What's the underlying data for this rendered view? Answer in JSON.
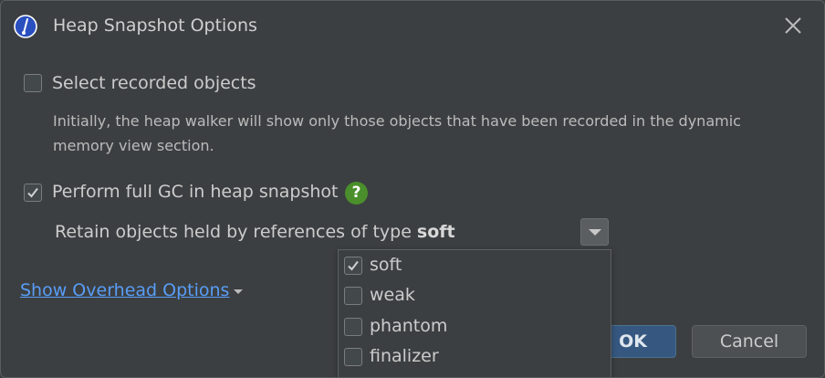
{
  "dialog": {
    "title": "Heap Snapshot Options",
    "icons": {
      "app": "jprofiler-icon",
      "close": "close-icon"
    }
  },
  "select_recorded": {
    "label": "Select recorded objects",
    "checked": false,
    "description": "Initially, the heap walker will show only those objects that have been recorded in the dynamic memory view section."
  },
  "full_gc": {
    "label": "Perform full GC in heap snapshot",
    "checked": true,
    "help_icon": "help-icon",
    "help_glyph": "?"
  },
  "retain": {
    "label": "Retain objects held by references of type",
    "selected": "soft",
    "options": [
      {
        "label": "soft",
        "checked": true
      },
      {
        "label": "weak",
        "checked": false
      },
      {
        "label": "phantom",
        "checked": false
      },
      {
        "label": "finalizer",
        "checked": false
      }
    ]
  },
  "overhead": {
    "label": "Show Overhead Options"
  },
  "buttons": {
    "ok": "OK",
    "cancel": "Cancel"
  },
  "colors": {
    "background": "#3c3f41",
    "link": "#589df6",
    "ok_button": "#365880",
    "help_badge": "#4a8f2b"
  }
}
